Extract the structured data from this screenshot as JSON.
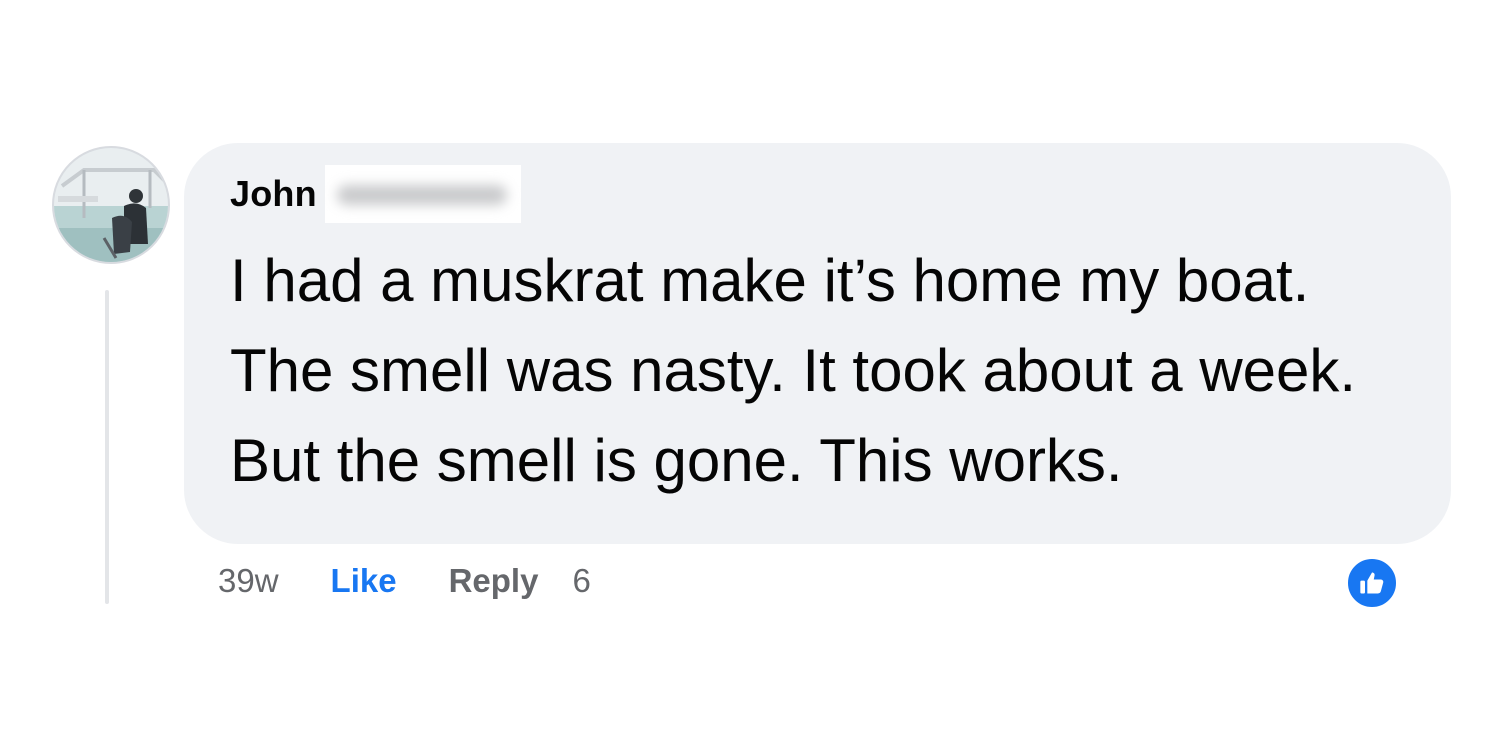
{
  "comment": {
    "author_first_name": "John",
    "text": "I had a muskrat make it’s home my boat. The smell was nasty. It took about a week. But the smell is gone. This works.",
    "time_ago": "39w",
    "like_label": "Like",
    "reply_label": "Reply",
    "reaction_count": "6",
    "reaction_icon": "thumbs-up-icon"
  },
  "colors": {
    "bubble_background": "#f0f2f5",
    "like_accent": "#1877f2",
    "meta_text": "#65676b",
    "body_text": "#050505"
  }
}
